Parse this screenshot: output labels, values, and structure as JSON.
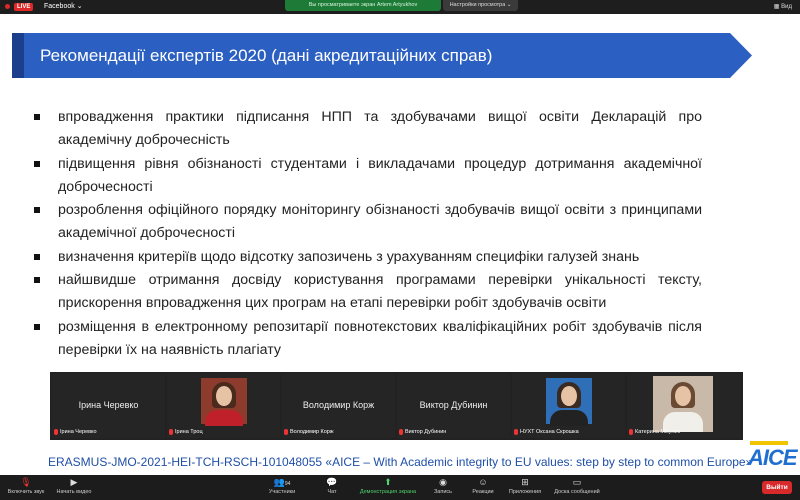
{
  "topbar": {
    "live_badge": "LIVE",
    "stream_target": "Facebook",
    "share_notice": "Вы просматриваете экран Artem Artyukhov",
    "view_settings": "Настройки просмотра",
    "view_button": "Вид"
  },
  "slide": {
    "title": "Рекомендації експертів 2020 (дані акредитаційних справ)",
    "bullets": [
      "впровадження практики підписання НПП та здобувачами вищої освіти Декларацій про академічну доброчесність",
      "підвищення рівня обізнаності студентами і викладачами процедур дотримання академічної доброчесності",
      "розроблення офіційного порядку моніторингу обізнаності здобувачів вищої освіти з принципами академічної доброчесності",
      "визначення критеріїв щодо відсотку запозичень з урахуванням специфіки галузей знань",
      "найшвидше отримання досвіду користування програмами перевірки унікальності тексту, прискорення впровадження цих програм на етапі перевірки робіт здобувачів освіти",
      "розміщення в електронному репозитарії повнотекстових кваліфікаційних робіт здобувачів після перевірки їх на наявність плагіату"
    ],
    "footer": "ERASMUS-JMO-2021-HEI-TCH-RSCH-101048055 «AICE – With Academic integrity to EU values: step by step to common Europe»",
    "logo_text": "AICE"
  },
  "participants": [
    {
      "big_name": "Ірина Черевко",
      "label": "Ірина Черевко",
      "video": false
    },
    {
      "big_name": "",
      "label": "Ірина Троц",
      "video": true
    },
    {
      "big_name": "Володимир Корж",
      "label": "Володимир Корж",
      "video": false
    },
    {
      "big_name": "Виктор Дубинин",
      "label": "Виктор Дубинин",
      "video": false
    },
    {
      "big_name": "",
      "label": "НУХТ Оксана Скрошка",
      "video": true
    },
    {
      "big_name": "",
      "label": "Катерина Мікулик",
      "video": true
    }
  ],
  "bottombar": {
    "items": [
      {
        "label": "Включить звук",
        "icon": "mic-muted-icon"
      },
      {
        "label": "Начать видео",
        "icon": "video-off-icon"
      },
      {
        "label": "Участники",
        "icon": "participants-icon",
        "count": "94"
      },
      {
        "label": "Чат",
        "icon": "chat-icon"
      },
      {
        "label": "Демонстрация экрана",
        "icon": "share-screen-icon"
      },
      {
        "label": "Запись",
        "icon": "record-icon"
      },
      {
        "label": "Реакции",
        "icon": "reactions-icon"
      },
      {
        "label": "Приложения",
        "icon": "apps-icon"
      },
      {
        "label": "Доска сообщений",
        "icon": "whiteboard-icon"
      }
    ],
    "leave": "Выйти"
  },
  "colors": {
    "banner": "#2b5fc1",
    "footer_text": "#1f4fa8",
    "share_green": "#1e7a37",
    "leave_red": "#d8292b"
  }
}
